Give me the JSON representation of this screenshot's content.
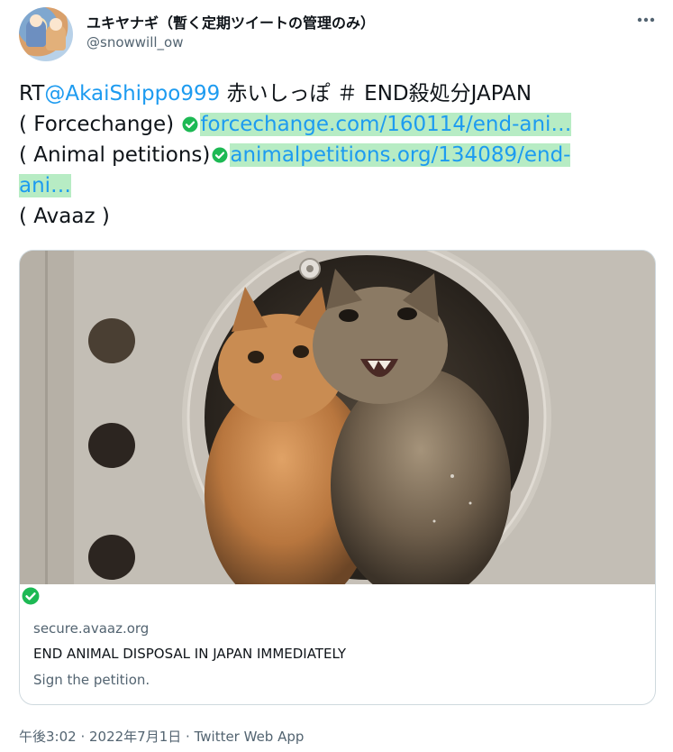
{
  "author": {
    "display_name": "ユキヤナギ（暫く定期ツイートの管理のみ）",
    "handle": "@snowwill_ow"
  },
  "tweet": {
    "rt_prefix": "RT",
    "mention": "@AkaiShippo999",
    "line1_rest": " 赤いしっぽ ＃ END殺処分JAPAN",
    "line2_label": "( Forcechange) ",
    "line2_link": "forcechange.com/160114/end-ani…",
    "line3_label": "( Animal petitions)",
    "line3_link_a": "animalpetitions.org/134089/end-",
    "line3_link_b": "ani…",
    "line5": "( Avaaz )"
  },
  "card": {
    "domain": "secure.avaaz.org",
    "title": "END ANIMAL DISPOSAL IN JAPAN IMMEDIATELY",
    "description": "Sign the petition."
  },
  "footer": {
    "time": "午後3:02",
    "sep1": " · ",
    "date": "2022年7月1日",
    "sep2": " · ",
    "source": "Twitter Web App"
  },
  "colors": {
    "link": "#1d9bf0",
    "link_highlight": "#b7ecc4",
    "check": "#1db954",
    "secondary": "#536471"
  },
  "icons": {
    "more": "more-dots-icon",
    "check": "green-check-icon"
  }
}
